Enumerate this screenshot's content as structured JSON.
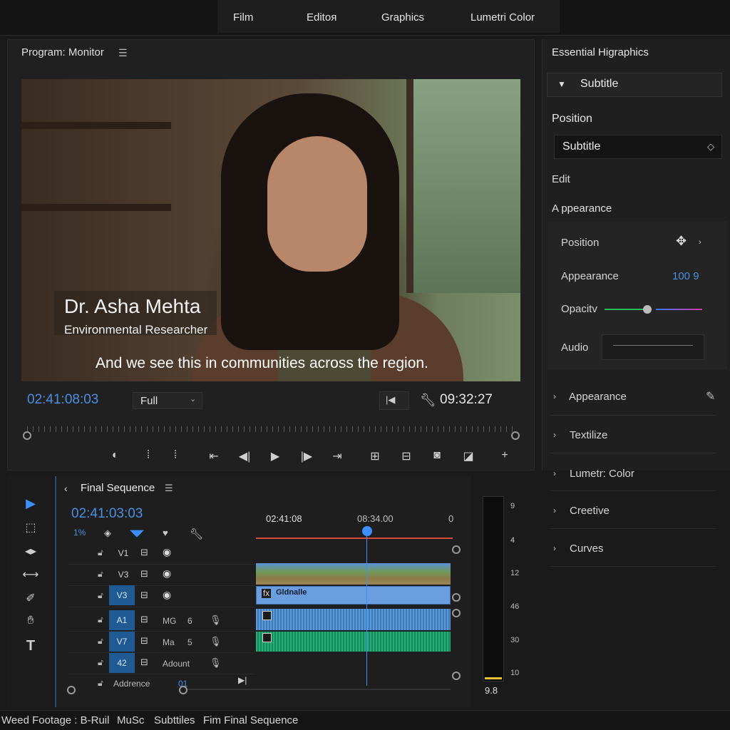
{
  "workspace_tabs": [
    "Film",
    "Editoя",
    "Graphics",
    "Lumetri Color"
  ],
  "program_monitor": {
    "title": "Program: Monitor",
    "menu_icon": "hamburger-icon",
    "lower_third_name": "Dr. Asha Mehta",
    "lower_third_title": "Environmental Researcher",
    "subtitle": "And we see this in communities across the region.",
    "timecode_left": "02:41:08:03",
    "zoom": "Full",
    "timecode_right": "09:32:27"
  },
  "essential_graphics": {
    "title": "Essential Higraphics",
    "layer_name": "Subtitle",
    "position_heading": "Position",
    "field_value": "Subtitle",
    "edit_label": "Edit",
    "appearance_heading": "A ppearance",
    "props": {
      "position_label": "Position",
      "appearance_label": "Appearance",
      "appearance_value": "100 9",
      "opacity_label": "Opacitv",
      "audio_label": "Audio"
    },
    "sections": [
      "Appearance",
      "Textilize",
      "Lumetr: Color",
      "Creetive",
      "Curves"
    ]
  },
  "timeline": {
    "title": "Final Sequence",
    "timecode": "02:41:03:03",
    "zoom_label": "1%",
    "ruler": [
      "02:41:08",
      "08:34.00",
      "0"
    ],
    "tracks": [
      {
        "label": "V1",
        "name": "",
        "num": ""
      },
      {
        "label": "V3",
        "name": "",
        "num": ""
      },
      {
        "label": "V3",
        "name": "",
        "num": ""
      },
      {
        "label": "A1",
        "name": "MG",
        "num": "6"
      },
      {
        "label": "V7",
        "name": "Ma",
        "num": "5"
      },
      {
        "label": "42",
        "name": "Adount",
        "num": ""
      },
      {
        "label": "",
        "name": "Addrence",
        "num": "01"
      }
    ],
    "graphic_clip_label": "Gldnalle"
  },
  "meter": {
    "ticks": [
      "9",
      "4",
      "12",
      "46",
      "30",
      "10"
    ],
    "value": "9.8",
    "level": 0.01
  },
  "status_bar": [
    "Weed Footage : B-Ruil",
    "MuSc",
    "Subttiles",
    "Fim Final Sequence"
  ]
}
